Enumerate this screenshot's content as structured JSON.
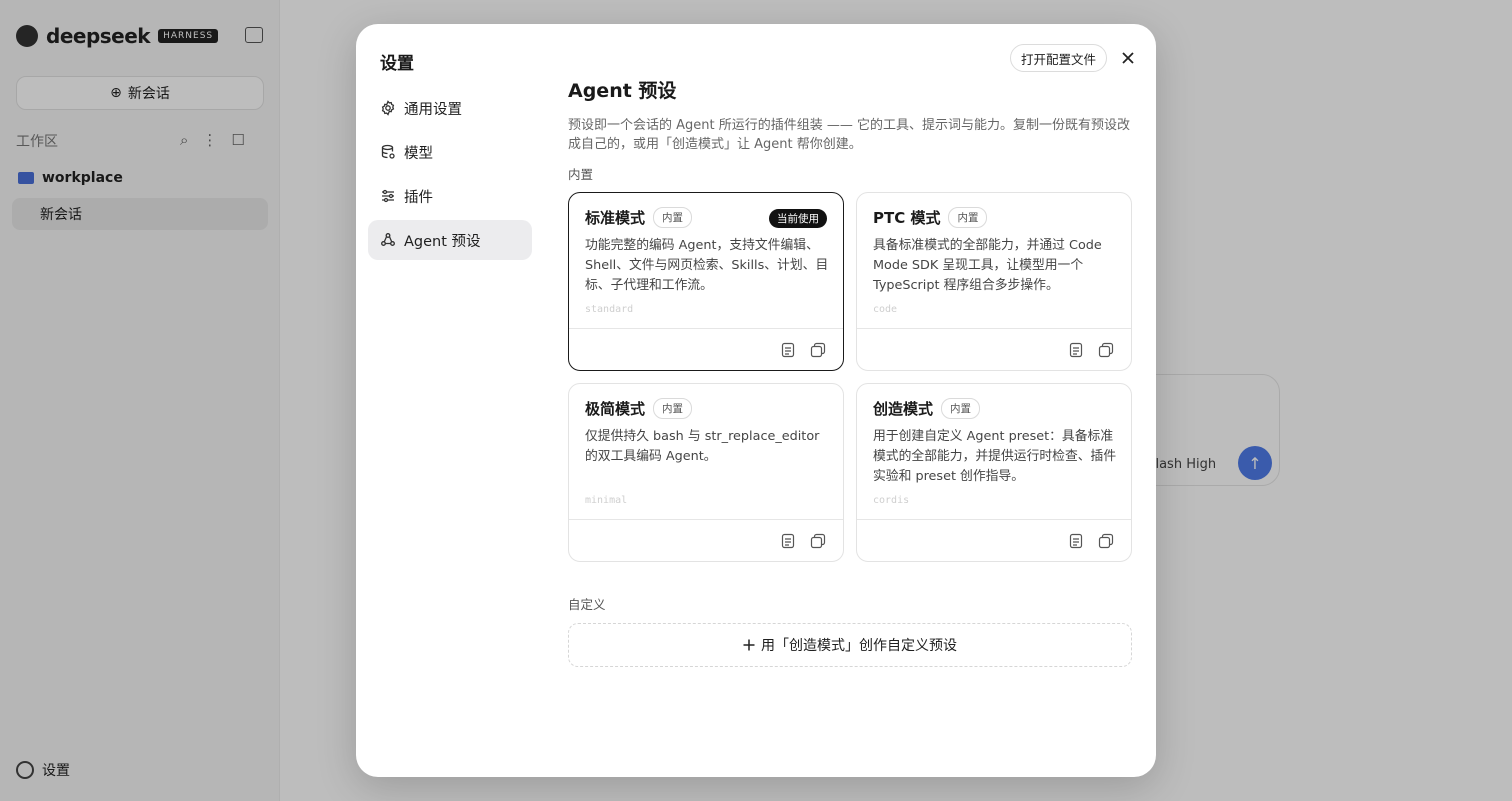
{
  "background": {
    "brand": "deepseek",
    "brand_badge": "HARNESS",
    "new_chat_label": "新会话",
    "workspace_label": "工作区",
    "folder_name": "workplace",
    "session_label": "新会话",
    "settings_label": "设置",
    "composer_model": "Flash  High"
  },
  "modal": {
    "title": "设置",
    "open_config_label": "打开配置文件",
    "nav": [
      {
        "label": "通用设置",
        "icon": "gear-icon"
      },
      {
        "label": "模型",
        "icon": "database-icon"
      },
      {
        "label": "插件",
        "icon": "sliders-icon"
      },
      {
        "label": "Agent 预设",
        "icon": "preset-icon"
      }
    ],
    "active_nav": 3
  },
  "agent_presets": {
    "title": "Agent 预设",
    "description": "预设即一个会话的 Agent 所运行的插件组装 —— 它的工具、提示词与能力。复制一份既有预设改成自己的，或用「创造模式」让 Agent 帮你创建。",
    "builtin_label": "内置",
    "custom_label": "自定义",
    "create_custom_label": "用「创造模式」创作自定义预设",
    "cards": [
      {
        "title": "标准模式",
        "tag": "内置",
        "badge": "当前使用",
        "description": "功能完整的编码 Agent，支持文件编辑、Shell、文件与网页检索、Skills、计划、目标、子代理和工作流。",
        "id": "standard"
      },
      {
        "title": "PTC 模式",
        "tag": "内置",
        "description": "具备标准模式的全部能力，并通过 Code Mode SDK 呈现工具，让模型用一个 TypeScript 程序组合多步操作。",
        "id": "code"
      },
      {
        "title": "极简模式",
        "tag": "内置",
        "description": "仅提供持久 bash 与 str_replace_editor 的双工具编码 Agent。",
        "id": "minimal"
      },
      {
        "title": "创造模式",
        "tag": "内置",
        "description": "用于创建自定义 Agent preset：具备标准模式的全部能力，并提供运行时检查、插件实验和 preset 创作指导。",
        "id": "cordis"
      }
    ]
  },
  "colors": {
    "accent": "#1a1a1a",
    "active_nav_bg": "#ececee",
    "overlay": "rgba(0,0,0,0.26)"
  }
}
